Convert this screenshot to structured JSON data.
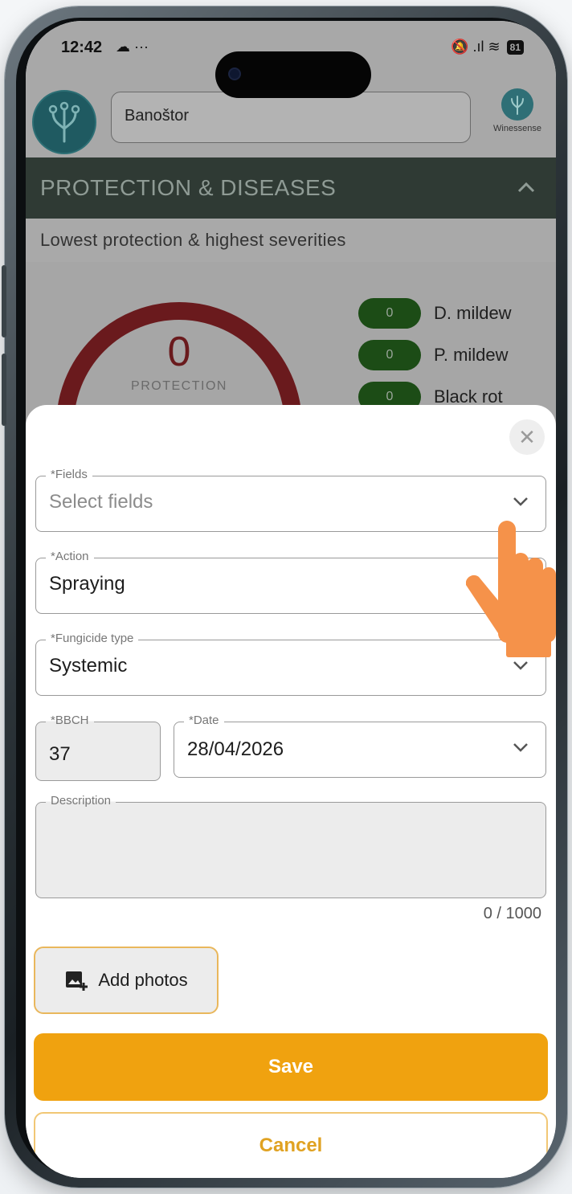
{
  "status_bar": {
    "time": "12:42",
    "notification_icons": "☁ ···",
    "signal_icons": "🔕 .ıl ≋",
    "battery_level": "81"
  },
  "header": {
    "location": "Banoštor",
    "brand_name": "Winessense"
  },
  "section": {
    "title": "PROTECTION & DISEASES",
    "subtitle": "Lowest protection & highest severities"
  },
  "protection": {
    "value": "0",
    "label": "PROTECTION"
  },
  "diseases": [
    {
      "count": "0",
      "name": "D. mildew"
    },
    {
      "count": "0",
      "name": "P. mildew"
    },
    {
      "count": "0",
      "name": "Black rot"
    }
  ],
  "form": {
    "fields": {
      "label": "*Fields",
      "placeholder": "Select fields"
    },
    "action": {
      "label": "*Action",
      "value": "Spraying"
    },
    "fungicide_type": {
      "label": "*Fungicide type",
      "value": "Systemic"
    },
    "bbch": {
      "label": "*BBCH",
      "value": "37"
    },
    "date": {
      "label": "*Date",
      "value": "28/04/2026"
    },
    "description": {
      "label": "Description",
      "value": "",
      "counter": "0 / 1000"
    },
    "add_photos_label": "Add photos",
    "save_label": "Save",
    "cancel_label": "Cancel"
  },
  "colors": {
    "accent": "#f0a20f",
    "section_bar": "#2f3a34",
    "protection_ring": "#6a1a1d",
    "disease_pill": "#1c4c16"
  },
  "icons": {
    "close": "close-icon",
    "dropdown": "chevron-down-icon",
    "add_photo": "add-photo-icon",
    "pointer": "hand-pointer-icon"
  }
}
